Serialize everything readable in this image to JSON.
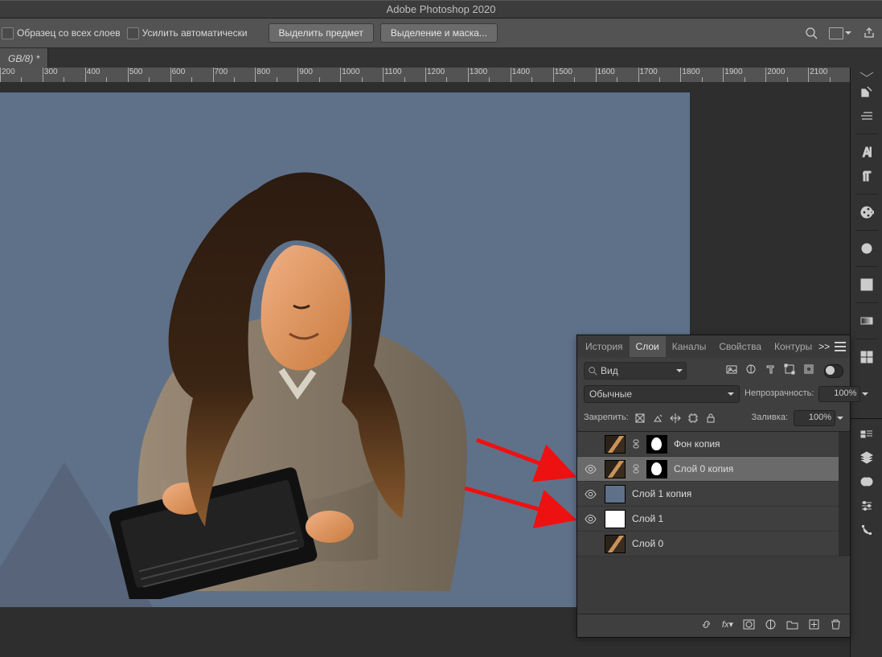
{
  "app_title": "Adobe Photoshop 2020",
  "options": {
    "sample_label": "Образец со всех слоев",
    "enhance_label": "Усилить автоматически",
    "select_subject": "Выделить предмет",
    "select_and_mask": "Выделение и маска..."
  },
  "doc_tab": "GB/8) *",
  "ruler": {
    "start": 200,
    "end": 2200,
    "step": 50,
    "major": 100
  },
  "panel": {
    "tabs": {
      "history": "История",
      "layers": "Слои",
      "channels": "Каналы",
      "properties": "Свойства",
      "paths": "Контуры"
    },
    "collapse": ">>",
    "search_kind": "Вид",
    "blend_mode": "Обычные",
    "opacity_label": "Непрозрачность:",
    "opacity_value": "100%",
    "lock_label": "Закрепить:",
    "fill_label": "Заливка:",
    "fill_value": "100%",
    "layers": [
      {
        "visible": false,
        "thumb": "img",
        "mask": true,
        "name": "Фон копия",
        "sel": false
      },
      {
        "visible": true,
        "thumb": "img",
        "mask": true,
        "name": "Слой 0 копия",
        "sel": true
      },
      {
        "visible": true,
        "thumb": "blue",
        "mask": false,
        "name": "Слой 1 копия",
        "sel": false
      },
      {
        "visible": true,
        "thumb": "white",
        "mask": false,
        "name": "Слой 1",
        "sel": false
      },
      {
        "visible": false,
        "thumb": "img",
        "mask": false,
        "name": "Слой 0",
        "sel": false
      }
    ]
  }
}
